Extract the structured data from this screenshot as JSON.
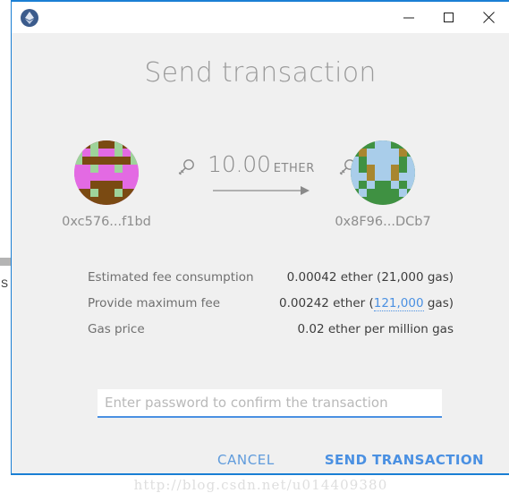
{
  "window": {
    "app_icon": "ethereum-logo-icon",
    "controls": {
      "minimize": "minimize-icon",
      "maximize": "maximize-icon",
      "close": "close-icon"
    }
  },
  "dialog": {
    "title": "Send transaction"
  },
  "transfer": {
    "from": {
      "address": "0xc576...f1bd",
      "key_icon": "key-icon",
      "identicon_colors": [
        "#e36ae3",
        "#7a4a12",
        "#9ed39a"
      ]
    },
    "to": {
      "address": "0x8F96...DCb7",
      "key_icon": "key-icon",
      "identicon_colors": [
        "#a9cdea",
        "#3f9142",
        "#a8862f"
      ]
    },
    "amount": "10.00",
    "unit": "ETHER",
    "arrow_icon": "arrow-right-icon"
  },
  "fees": {
    "rows": [
      {
        "label": "Estimated fee consumption",
        "value_prefix": "0.00042 ether (",
        "editable": "21,000",
        "editable_is_link": false,
        "value_suffix": " gas)"
      },
      {
        "label": "Provide maximum fee",
        "value_prefix": "0.00242 ether (",
        "editable": "121,000",
        "editable_is_link": true,
        "value_suffix": " gas)"
      },
      {
        "label": "Gas price",
        "value_prefix": "0.02 ether per million gas",
        "editable": "",
        "editable_is_link": false,
        "value_suffix": ""
      }
    ]
  },
  "password": {
    "placeholder": "Enter password to confirm the transaction",
    "value": ""
  },
  "actions": {
    "cancel_label": "CANCEL",
    "send_label": "SEND TRANSACTION"
  },
  "watermark": {
    "text": "http://blog.csdn.net/u014409380"
  },
  "background_window": {
    "glyph": "S"
  },
  "colors": {
    "accent_blue": "#4a90e2",
    "window_border": "#1a7fd4",
    "dialog_bg": "#f0f0f0",
    "title_gray": "#9b9b9b"
  }
}
